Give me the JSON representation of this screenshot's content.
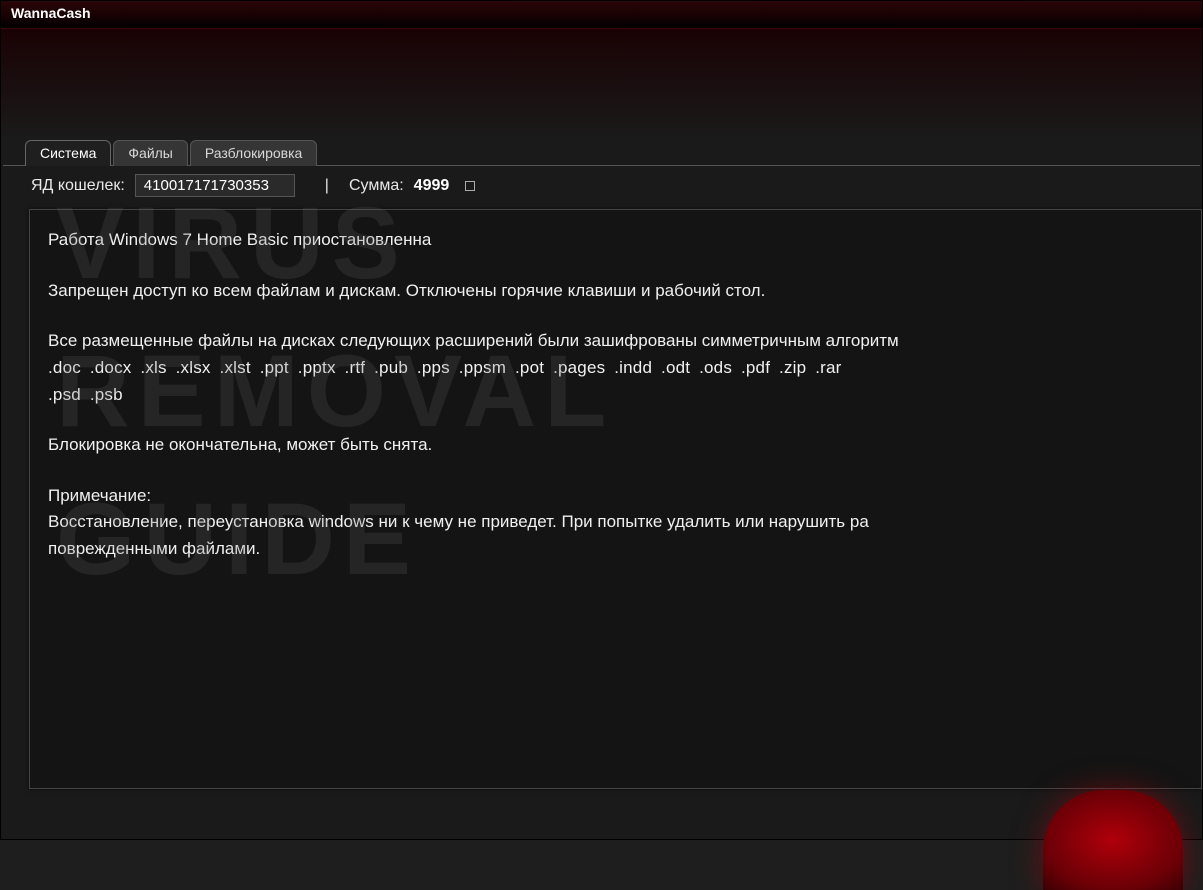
{
  "window": {
    "title": "WannaCash"
  },
  "tabs": [
    {
      "label": "Система",
      "active": true
    },
    {
      "label": "Файлы",
      "active": false
    },
    {
      "label": "Разблокировка",
      "active": false
    }
  ],
  "info": {
    "wallet_label": "ЯД кошелек:",
    "wallet_value": "410017171730353",
    "sum_label": "Сумма:",
    "sum_value": "4999"
  },
  "message": {
    "line1": "Работа Windows 7 Home Basic приостановленна",
    "line2": "Запрещен доступ ко всем файлам и дискам. Отключены горячие клавиши и рабочий стол.",
    "line3": "Все размещенные файлы на дисках следующих расширений были зашифрованы симметричным алгоритм",
    "line4": ".doc  .docx  .xls  .xlsx  .xlst  .ppt  .pptx  .rtf  .pub  .pps  .ppsm  .pot  .pages  .indd  .odt  .ods  .pdf  .zip  .rar",
    "line5": ".psd   .psb",
    "line6": "Блокировка не окончательна,  может быть снята.",
    "line7": "Примечание:",
    "line8": "Восстановление, переустановка windows ни к чему не приведет. При попытке удалить или нарушить ра",
    "line9": "поврежденными файлами."
  },
  "watermark": {
    "line1": "VIRUS",
    "line2": "REMOVAL",
    "line3": "GUIDE"
  }
}
